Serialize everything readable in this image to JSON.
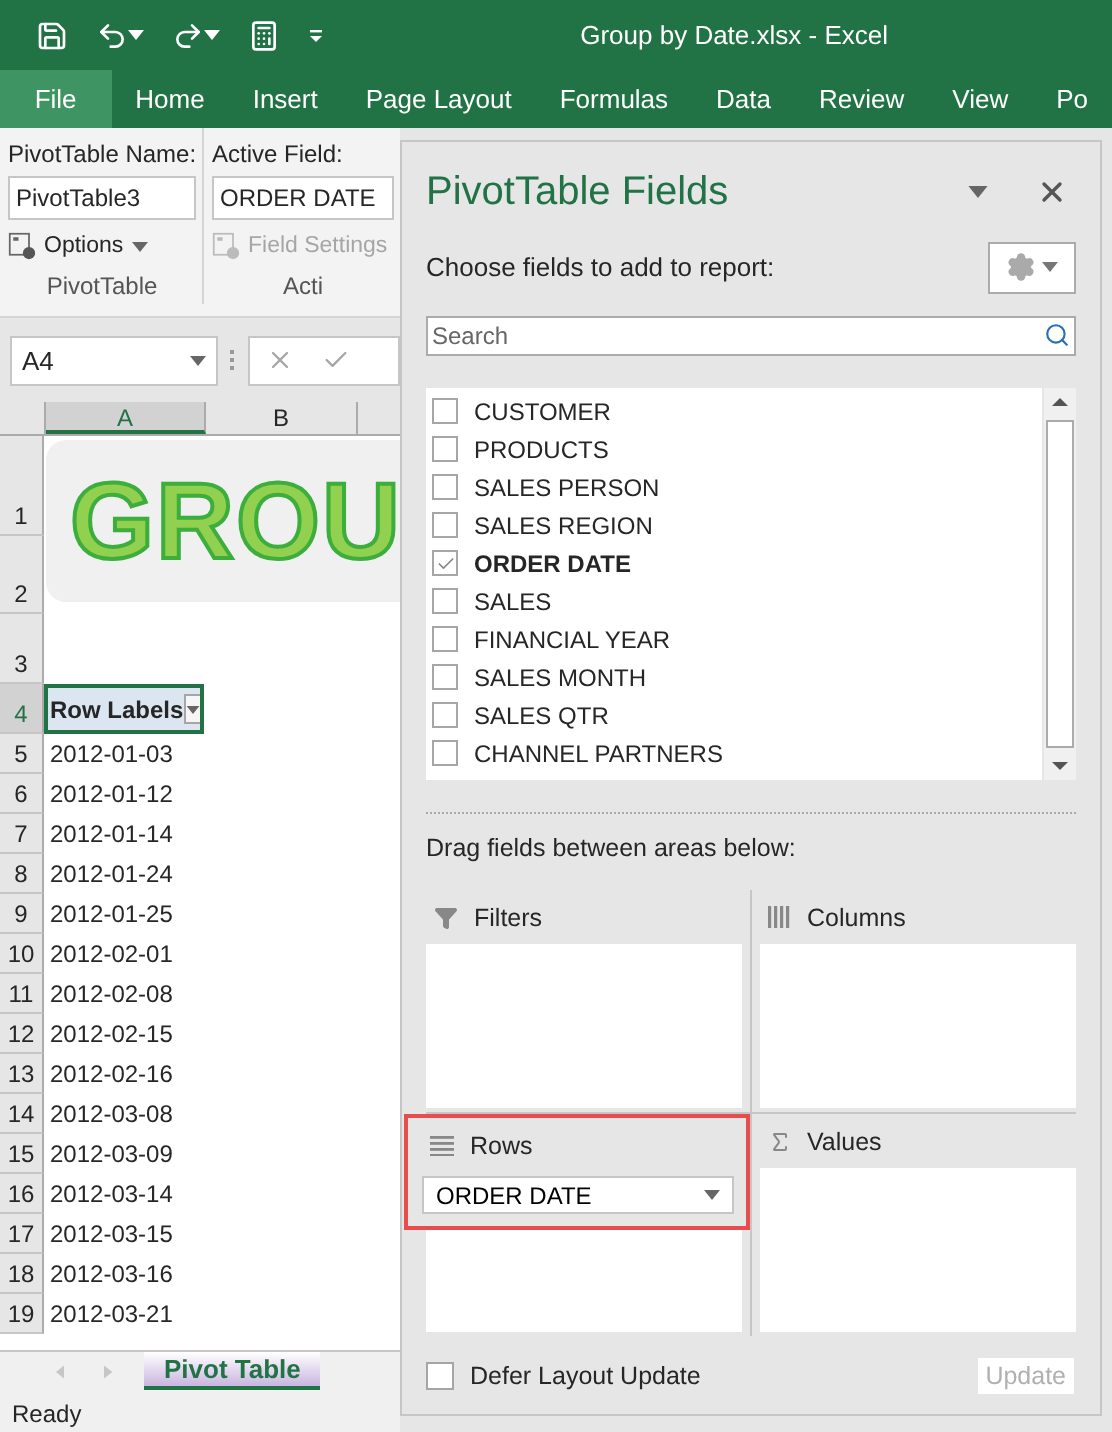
{
  "title_bar": {
    "title": "Group by Date.xlsx - Excel"
  },
  "ribbon_tabs": [
    {
      "label": "File",
      "kind": "file"
    },
    {
      "label": "Home",
      "kind": "tab"
    },
    {
      "label": "Insert",
      "kind": "tab"
    },
    {
      "label": "Page Layout",
      "kind": "tab"
    },
    {
      "label": "Formulas",
      "kind": "tab"
    },
    {
      "label": "Data",
      "kind": "tab"
    },
    {
      "label": "Review",
      "kind": "tab"
    },
    {
      "label": "View",
      "kind": "tab"
    },
    {
      "label": "Po",
      "kind": "tab"
    }
  ],
  "ribbon_groups": [
    {
      "label": "PivotTable",
      "field_label": "PivotTable Name:",
      "field_value": "PivotTable3",
      "button": {
        "label": "Options",
        "disabled": false
      }
    },
    {
      "label": "Acti",
      "field_label": "Active Field:",
      "field_value": "ORDER DATE",
      "button": {
        "label": "Field Settings",
        "disabled": true
      }
    }
  ],
  "formula_bar": {
    "name_box": "A4"
  },
  "sheet": {
    "columns": [
      {
        "label": "A",
        "selected": true
      },
      {
        "label": "B",
        "selected": false
      }
    ],
    "banner": "GROU",
    "rows": [
      {
        "number": "1",
        "kind": "banner",
        "selected": false
      },
      {
        "number": "2",
        "kind": "banner",
        "selected": false
      },
      {
        "number": "3",
        "kind": "empty",
        "selected": false
      },
      {
        "number": "4",
        "kind": "header",
        "cell": "Row Labels",
        "selected": true
      },
      {
        "number": "5",
        "kind": "data",
        "cell": "2012-01-03",
        "selected": false
      },
      {
        "number": "6",
        "kind": "data",
        "cell": "2012-01-12",
        "selected": false
      },
      {
        "number": "7",
        "kind": "data",
        "cell": "2012-01-14",
        "selected": false
      },
      {
        "number": "8",
        "kind": "data",
        "cell": "2012-01-24",
        "selected": false
      },
      {
        "number": "9",
        "kind": "data",
        "cell": "2012-01-25",
        "selected": false
      },
      {
        "number": "10",
        "kind": "data",
        "cell": "2012-02-01",
        "selected": false
      },
      {
        "number": "11",
        "kind": "data",
        "cell": "2012-02-08",
        "selected": false
      },
      {
        "number": "12",
        "kind": "data",
        "cell": "2012-02-15",
        "selected": false
      },
      {
        "number": "13",
        "kind": "data",
        "cell": "2012-02-16",
        "selected": false
      },
      {
        "number": "14",
        "kind": "data",
        "cell": "2012-03-08",
        "selected": false
      },
      {
        "number": "15",
        "kind": "data",
        "cell": "2012-03-09",
        "selected": false
      },
      {
        "number": "16",
        "kind": "data",
        "cell": "2012-03-14",
        "selected": false
      },
      {
        "number": "17",
        "kind": "data",
        "cell": "2012-03-15",
        "selected": false
      },
      {
        "number": "18",
        "kind": "data",
        "cell": "2012-03-16",
        "selected": false
      },
      {
        "number": "19",
        "kind": "data",
        "cell": "2012-03-21",
        "selected": false
      }
    ]
  },
  "sheet_tabs": [
    {
      "label": "Pivot Table",
      "selected": true
    }
  ],
  "status_bar": {
    "text": "Ready"
  },
  "pane": {
    "title": "PivotTable Fields",
    "subtitle": "Choose fields to add to report:",
    "search": {
      "placeholder": "Search"
    },
    "fields": [
      {
        "label": "CUSTOMER",
        "checked": false
      },
      {
        "label": "PRODUCTS",
        "checked": false
      },
      {
        "label": "SALES PERSON",
        "checked": false
      },
      {
        "label": "SALES REGION",
        "checked": false
      },
      {
        "label": "ORDER DATE",
        "checked": true
      },
      {
        "label": "SALES",
        "checked": false
      },
      {
        "label": "FINANCIAL YEAR",
        "checked": false
      },
      {
        "label": "SALES MONTH",
        "checked": false
      },
      {
        "label": "SALES QTR",
        "checked": false
      },
      {
        "label": "CHANNEL PARTNERS",
        "checked": false
      }
    ],
    "areas_hint": "Drag fields between areas below:",
    "areas": [
      {
        "kind": "filters",
        "label": "Filters",
        "highlighted": false
      },
      {
        "kind": "columns",
        "label": "Columns",
        "highlighted": false
      },
      {
        "kind": "rows",
        "label": "Rows",
        "items": [
          "ORDER DATE"
        ],
        "highlighted": true
      },
      {
        "kind": "values",
        "label": "Values",
        "highlighted": false
      }
    ],
    "defer": {
      "label": "Defer Layout Update",
      "checked": false
    },
    "update_button": {
      "label": "Update",
      "disabled": true
    }
  }
}
